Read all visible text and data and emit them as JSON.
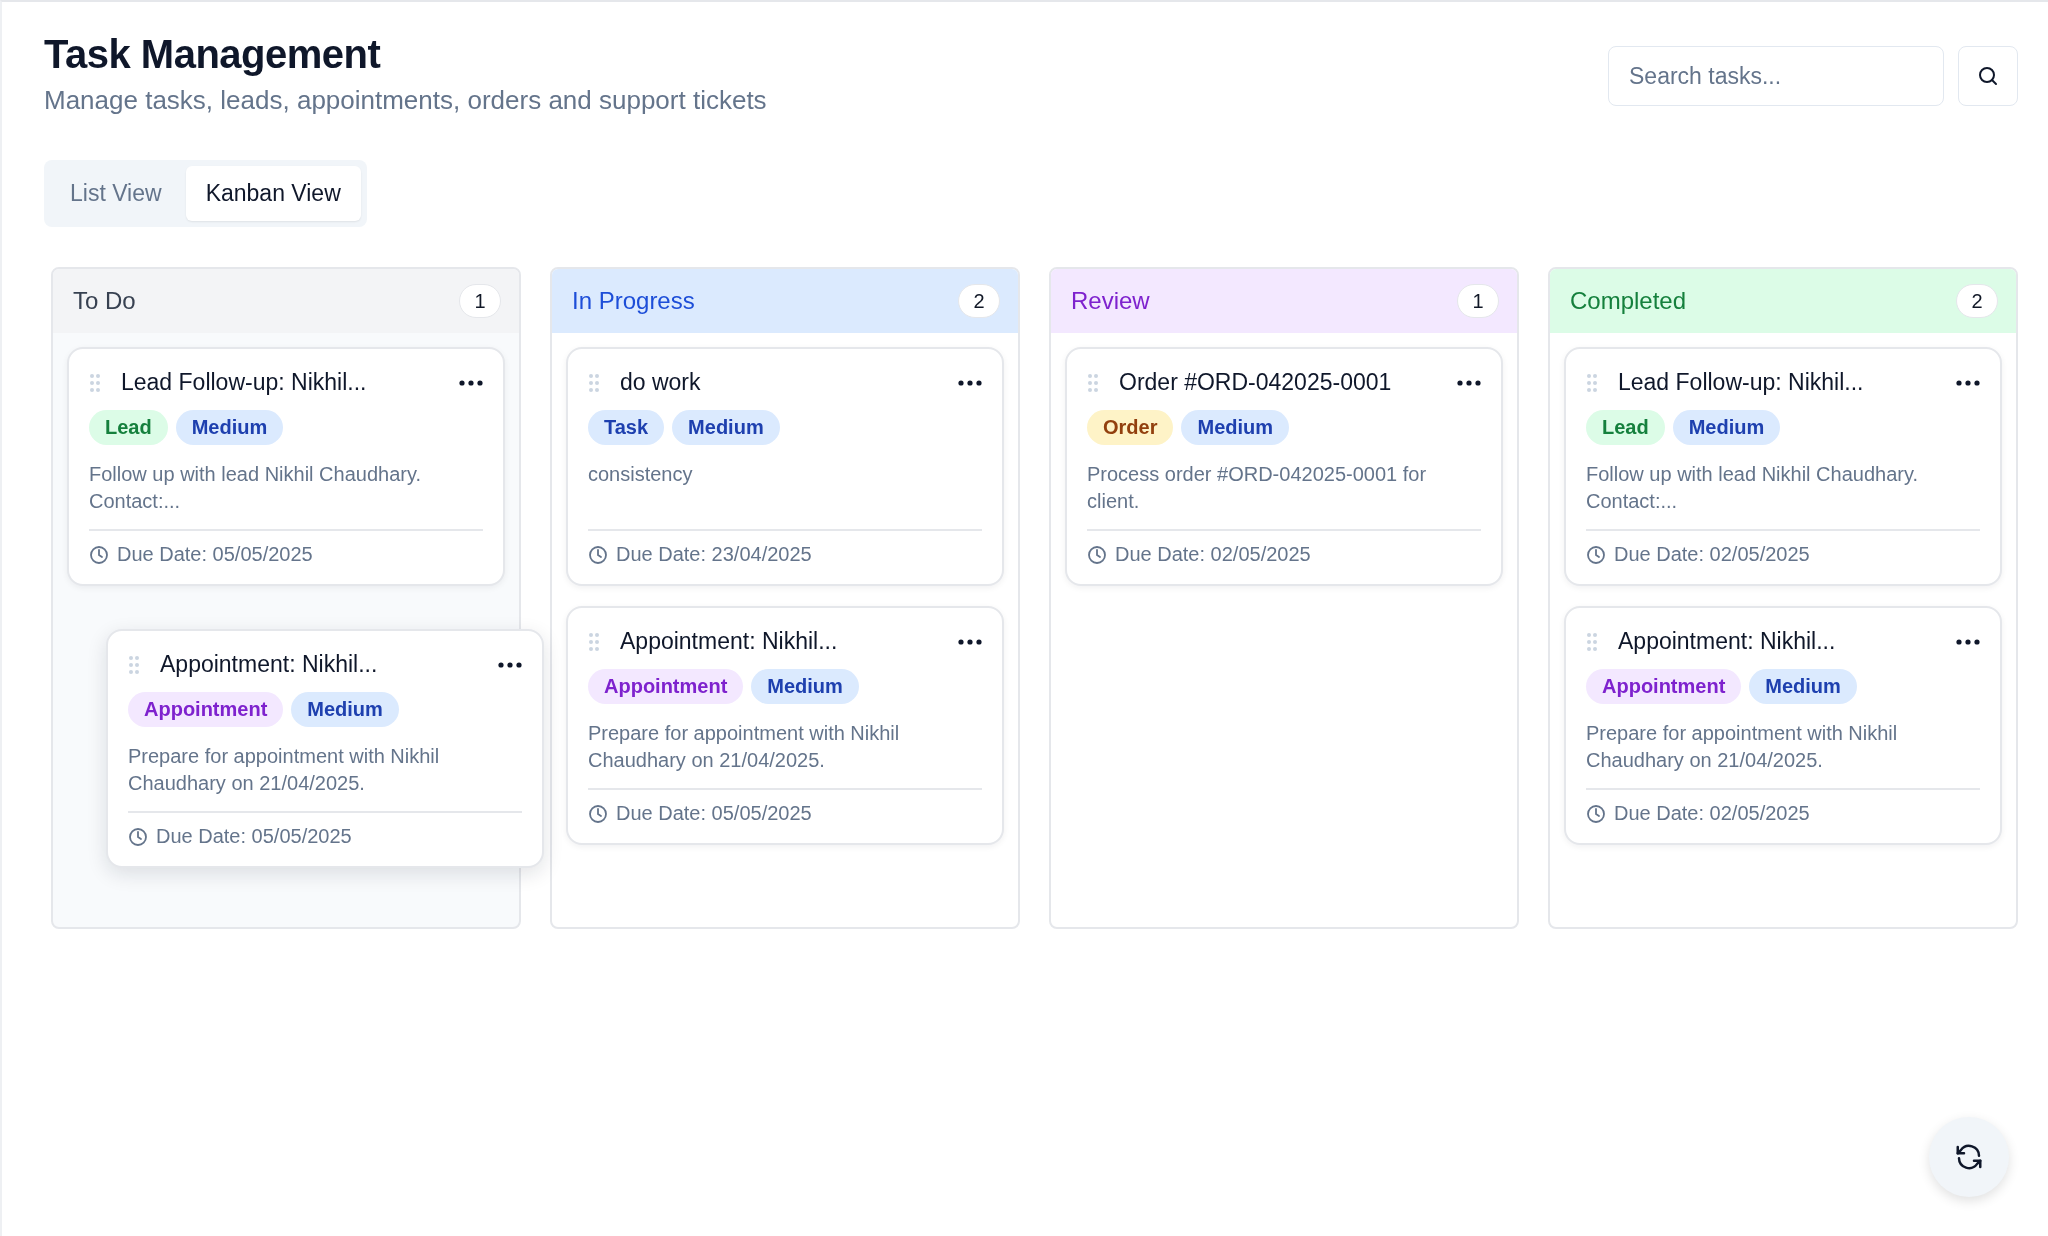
{
  "header": {
    "title": "Task Management",
    "subtitle": "Manage tasks, leads, appointments, orders and support tickets"
  },
  "search": {
    "placeholder": "Search tasks..."
  },
  "tabs": [
    {
      "label": "List View",
      "selected": false
    },
    {
      "label": "Kanban View",
      "selected": true
    }
  ],
  "columns": [
    {
      "title": "To Do",
      "kind": "todo",
      "count": "1",
      "cards": [
        {
          "title": "Lead Follow-up: Nikhil...",
          "tags": [
            {
              "label": "Lead",
              "kind": "lead"
            },
            {
              "label": "Medium",
              "kind": "priority"
            }
          ],
          "description": "Follow up with lead Nikhil Chaudhary. Contact:...",
          "due": "Due Date: 05/05/2025"
        }
      ]
    },
    {
      "title": "In Progress",
      "kind": "progress",
      "count": "2",
      "cards": [
        {
          "title": "do work",
          "tags": [
            {
              "label": "Task",
              "kind": "task"
            },
            {
              "label": "Medium",
              "kind": "priority"
            }
          ],
          "description": "consistency",
          "due": "Due Date: 23/04/2025"
        },
        {
          "title": "Appointment: Nikhil...",
          "tags": [
            {
              "label": "Appointment",
              "kind": "appointment"
            },
            {
              "label": "Medium",
              "kind": "priority"
            }
          ],
          "description": "Prepare for appointment with Nikhil Chaudhary on 21/04/2025.",
          "due": "Due Date: 05/05/2025"
        }
      ]
    },
    {
      "title": "Review",
      "kind": "review",
      "count": "1",
      "cards": [
        {
          "title": "Order #ORD-042025-0001",
          "tags": [
            {
              "label": "Order",
              "kind": "order"
            },
            {
              "label": "Medium",
              "kind": "priority"
            }
          ],
          "description": "Process order #ORD-042025-0001 for client.",
          "due": "Due Date: 02/05/2025"
        }
      ]
    },
    {
      "title": "Completed",
      "kind": "done",
      "count": "2",
      "cards": [
        {
          "title": "Lead Follow-up: Nikhil...",
          "tags": [
            {
              "label": "Lead",
              "kind": "lead"
            },
            {
              "label": "Medium",
              "kind": "priority"
            }
          ],
          "description": "Follow up with lead Nikhil Chaudhary. Contact:...",
          "due": "Due Date: 02/05/2025"
        },
        {
          "title": "Appointment: Nikhil...",
          "tags": [
            {
              "label": "Appointment",
              "kind": "appointment"
            },
            {
              "label": "Medium",
              "kind": "priority"
            }
          ],
          "description": "Prepare for appointment with Nikhil Chaudhary on 21/04/2025.",
          "due": "Due Date: 02/05/2025"
        }
      ]
    }
  ],
  "drag_preview": {
    "title": "Appointment: Nikhil...",
    "tags": [
      {
        "label": "Appointment",
        "kind": "appointment"
      },
      {
        "label": "Medium",
        "kind": "priority"
      }
    ],
    "description": "Prepare for appointment with Nikhil Chaudhary on 21/04/2025.",
    "due": "Due Date: 05/05/2025"
  }
}
